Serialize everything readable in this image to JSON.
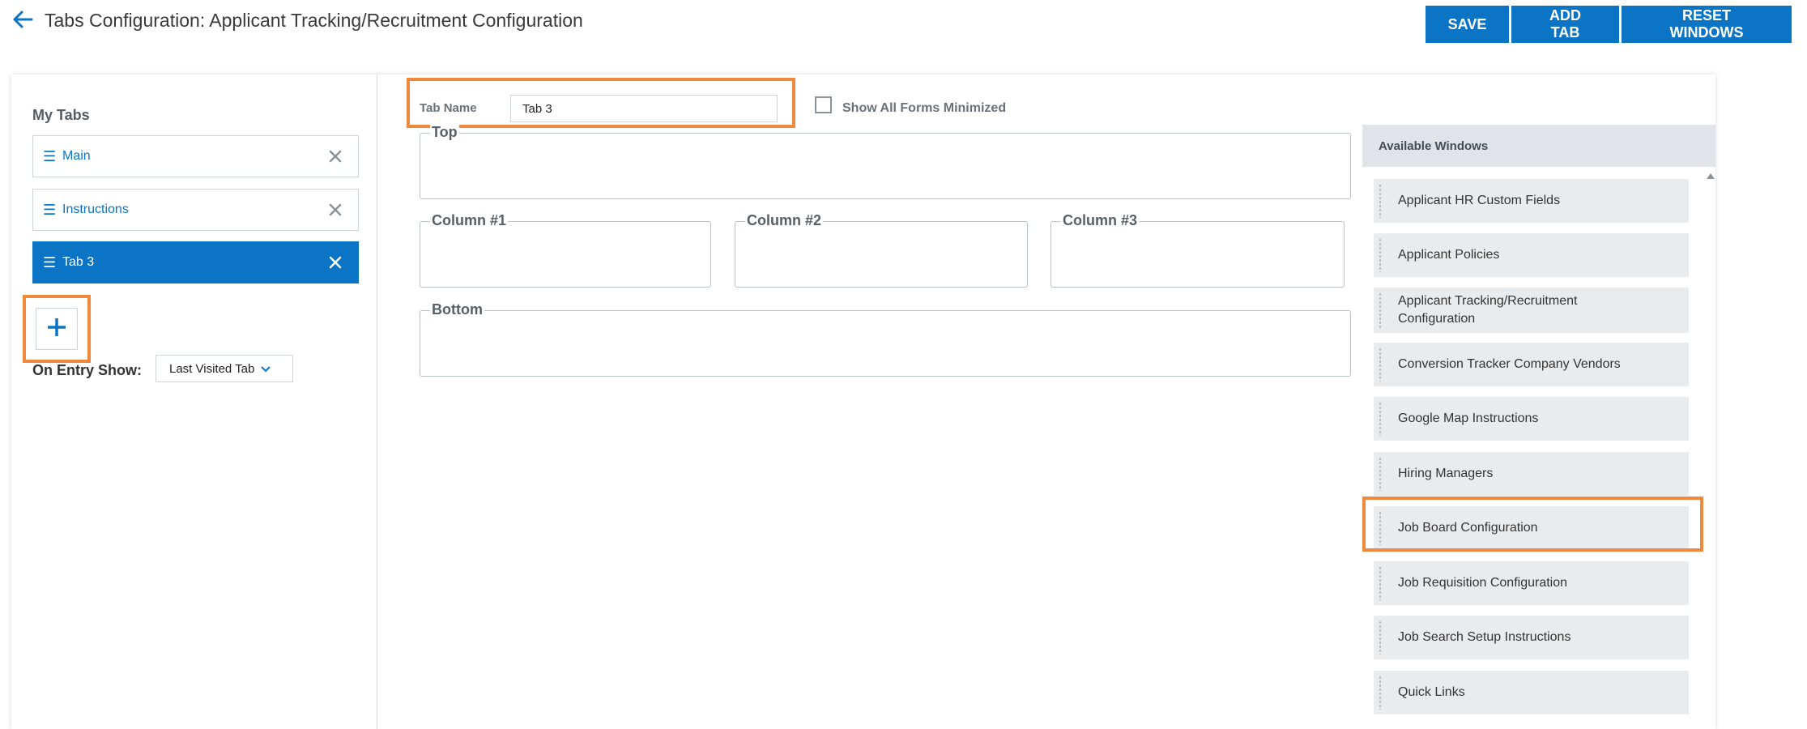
{
  "header": {
    "title": "Tabs Configuration: Applicant Tracking/Recruitment Configuration",
    "back_icon": "arrow-left-icon"
  },
  "toolbar": {
    "save_label": "SAVE",
    "add_tab_label": "ADD TAB",
    "reset_windows_label": "RESET WINDOWS"
  },
  "colors": {
    "accent": "#0b74c4",
    "highlight": "#f0883e"
  },
  "my_tabs": {
    "label": "My Tabs",
    "items": [
      {
        "label": "Main",
        "active": false
      },
      {
        "label": "Instructions",
        "active": false
      },
      {
        "label": "Tab 3",
        "active": true
      }
    ],
    "add_icon": "plus-icon"
  },
  "entry": {
    "label": "On Entry Show:",
    "selected": "Last Visited Tab"
  },
  "editor": {
    "tab_name_label": "Tab Name",
    "tab_name_value": "Tab 3",
    "show_minimized_label": "Show All Forms Minimized",
    "show_minimized_checked": false,
    "zones": {
      "top": "Top",
      "col1": "Column #1",
      "col2": "Column #2",
      "col3": "Column #3",
      "bottom": "Bottom"
    }
  },
  "available_windows": {
    "header": "Available Windows",
    "items": [
      "Applicant HR Custom Fields",
      "Applicant Policies",
      "Applicant Tracking/Recruitment Configuration",
      "Conversion Tracker Company Vendors",
      "Google Map Instructions",
      "Hiring Managers",
      "Job Board Configuration",
      "Job Requisition Configuration",
      "Job Search Setup Instructions",
      "Quick Links"
    ]
  }
}
